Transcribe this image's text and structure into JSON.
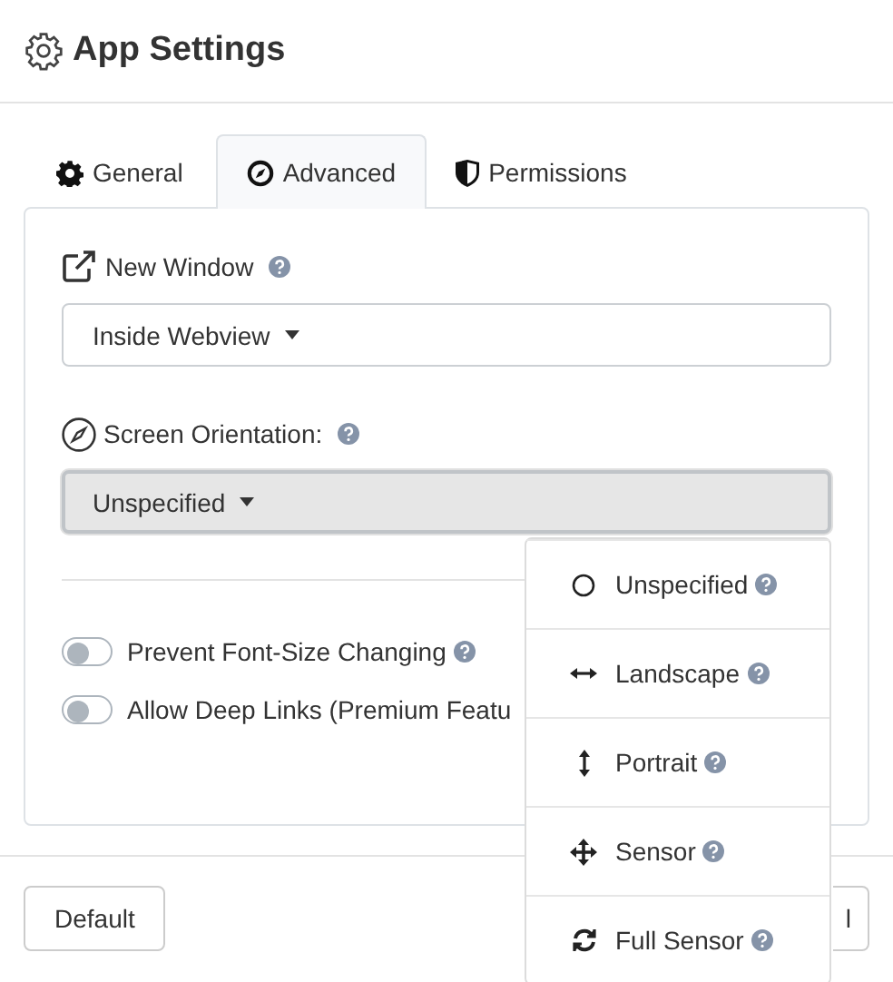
{
  "window": {
    "title": "App Settings"
  },
  "tabs": [
    {
      "label": "General",
      "selected": false
    },
    {
      "label": "Advanced",
      "selected": true
    },
    {
      "label": "Permissions",
      "selected": false
    }
  ],
  "fields": [
    {
      "label": "New Window",
      "value": "Inside Webview",
      "expanded": false
    },
    {
      "label": "Screen Orientation:",
      "value": "Unspecified",
      "expanded": true
    }
  ],
  "toggles": [
    {
      "label": "Prevent Font-Size Changing",
      "on": false,
      "help": true
    },
    {
      "label": "Allow Deep Links (Premium Featu",
      "on": false,
      "help": false
    }
  ],
  "footer": {
    "buttons": [
      "Default",
      "l"
    ]
  },
  "menu": {
    "items": [
      "Unspecified",
      "Landscape",
      "Portrait",
      "Sensor",
      "Full Sensor"
    ]
  }
}
